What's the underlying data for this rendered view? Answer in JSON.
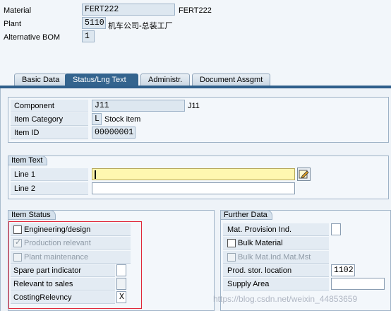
{
  "header": {
    "material_label": "Material",
    "material_value": "FERT222",
    "material_desc": "FERT222",
    "plant_label": "Plant",
    "plant_value": "5110",
    "plant_desc": "机车公司-总装工厂",
    "altbom_label": "Alternative BOM",
    "altbom_value": "1"
  },
  "tabs": [
    {
      "label": "Basic Data"
    },
    {
      "label": "Status/Lng Text",
      "active": true
    },
    {
      "label": "Administr."
    },
    {
      "label": "Document Assgmt"
    }
  ],
  "item": {
    "component_label": "Component",
    "component_value": "J11",
    "component_desc": "J11",
    "category_label": "Item Category",
    "category_value": "L",
    "category_desc": "Stock item",
    "itemid_label": "Item ID",
    "itemid_value": "00000001"
  },
  "item_text": {
    "title": "Item Text",
    "line1_label": "Line 1",
    "line1_value": "",
    "line2_label": "Line 2",
    "line2_value": ""
  },
  "item_status": {
    "title": "Item Status",
    "engineering_label": "Engineering/design",
    "engineering_checked": false,
    "production_label": "Production relevant",
    "production_checked": true,
    "plant_maint_label": "Plant maintenance",
    "plant_maint_checked": false,
    "spare_label": "Spare part indicator",
    "spare_value": "",
    "sales_label": "Relevant to sales",
    "sales_value": "",
    "costing_label": "CostingRelevncy",
    "costing_value": "X"
  },
  "further_data": {
    "title": "Further Data",
    "mat_prov_label": "Mat. Provision Ind.",
    "mat_prov_value": "",
    "bulk_label": "Bulk Material",
    "bulk_checked": false,
    "bulk_ind_label": "Bulk Mat.Ind.Mat.Mst",
    "bulk_ind_checked": false,
    "prod_loc_label": "Prod. stor. location",
    "prod_loc_value": "1102",
    "supply_label": "Supply Area",
    "supply_value": ""
  },
  "watermark": "https://blog.csdn.net/weixin_44853659",
  "colors": {
    "active_tab": "#34648e",
    "focus_field": "#fff7b0",
    "highlight_border": "#e0283a"
  }
}
